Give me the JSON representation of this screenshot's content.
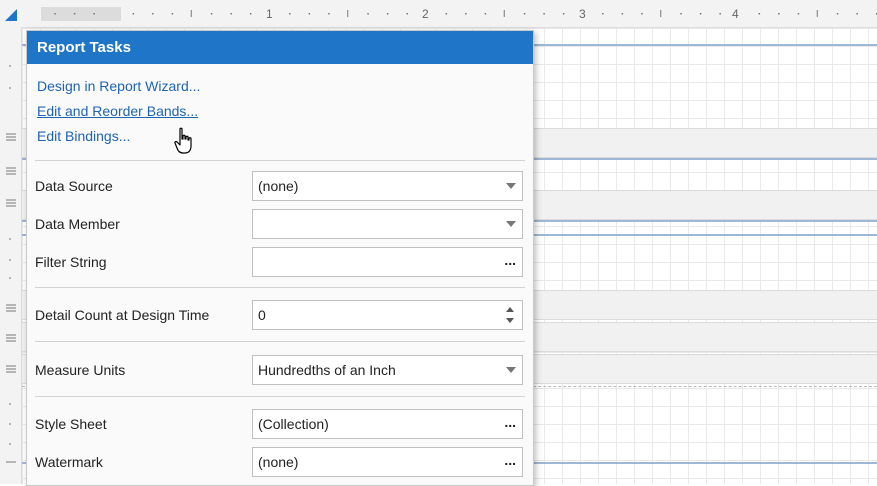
{
  "ruler": {
    "marks": [
      "1",
      "2",
      "3",
      "4"
    ]
  },
  "panel": {
    "title": "Report Tasks",
    "links": [
      {
        "label": "Design in Report Wizard..."
      },
      {
        "label": "Edit and Reorder Bands..."
      },
      {
        "label": "Edit Bindings..."
      }
    ],
    "fields": {
      "data_source": {
        "label": "Data Source",
        "value": "(none)"
      },
      "data_member": {
        "label": "Data Member",
        "value": ""
      },
      "filter_string": {
        "label": "Filter String",
        "value": ""
      },
      "detail_count": {
        "label": "Detail Count at Design Time",
        "value": "0"
      },
      "measure_units": {
        "label": "Measure Units",
        "value": "Hundredths of an Inch"
      },
      "style_sheet": {
        "label": "Style Sheet",
        "value": "(Collection)"
      },
      "watermark": {
        "label": "Watermark",
        "value": "(none)"
      }
    },
    "ellipsis": "..."
  },
  "colors": {
    "accent": "#1f76c8",
    "link": "#1e63b3"
  }
}
